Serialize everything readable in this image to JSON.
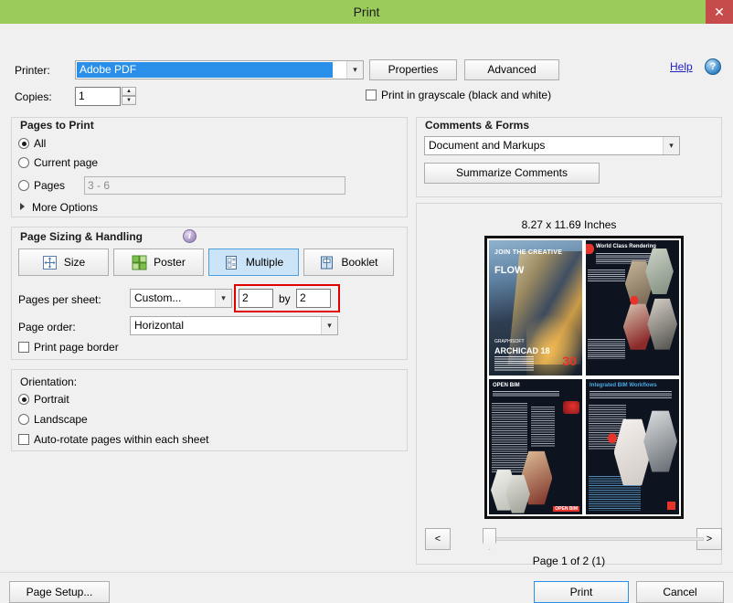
{
  "window": {
    "title": "Print",
    "close_label": "✕"
  },
  "printer": {
    "label": "Printer:",
    "selected": "Adobe PDF",
    "properties_label": "Properties",
    "advanced_label": "Advanced",
    "help_label": "Help",
    "help_icon": "?",
    "copies_label": "Copies:",
    "copies_value": "1",
    "spin_up": "▲",
    "spin_down": "▼",
    "grayscale_label": "Print in grayscale (black and white)",
    "grayscale_checked": false,
    "accent_selection": "#2a8fe8"
  },
  "pages_to_print": {
    "title": "Pages to Print",
    "all_label": "All",
    "current_page_label": "Current page",
    "pages_label": "Pages",
    "pages_placeholder": "3 - 6",
    "more_options_label": "More Options",
    "selected": "All"
  },
  "page_sizing": {
    "title": "Page Sizing & Handling",
    "info_icon": "i",
    "modes": [
      {
        "label": "Size",
        "icon": "resize-icon",
        "active": false
      },
      {
        "label": "Poster",
        "icon": "poster-grid-icon",
        "active": false
      },
      {
        "label": "Multiple",
        "icon": "multiple-pages-icon",
        "active": true
      },
      {
        "label": "Booklet",
        "icon": "booklet-icon",
        "active": false
      }
    ],
    "pages_per_sheet_label": "Pages per sheet:",
    "pages_per_sheet_value": "Custom...",
    "grid_x": "2",
    "by_label": "by",
    "grid_y": "2",
    "highlight_color": "#e00000",
    "page_order_label": "Page order:",
    "page_order_value": "Horizontal",
    "print_page_border_label": "Print page border",
    "print_page_border_checked": false
  },
  "orientation": {
    "title": "Orientation:",
    "portrait_label": "Portrait",
    "landscape_label": "Landscape",
    "selected": "Portrait",
    "auto_rotate_label": "Auto-rotate pages within each sheet",
    "auto_rotate_checked": false
  },
  "comments_forms": {
    "title": "Comments & Forms",
    "selected": "Document and Markups",
    "summarize_label": "Summarize Comments"
  },
  "preview": {
    "size_label": "8.27 x 11.69 Inches",
    "page_indicator": "Page 1 of 2 (1)",
    "prev_label": "<",
    "next_label": ">",
    "pages": [
      {
        "name": "archicad-cover",
        "headline": "JOIN THE CREATIVE",
        "headline2": "FLOW",
        "brand": "GRAPHISOFT",
        "product": "ARCHICAD 18",
        "badge": "30"
      },
      {
        "name": "world-class-rendering",
        "headline": "World Class Rendering"
      },
      {
        "name": "open-bim",
        "headline": "OPEN BIM",
        "logo_text": "OPEN BIM"
      },
      {
        "name": "integrated-bim-workflows",
        "headline": "Integrated BIM Workflows"
      }
    ]
  },
  "footer": {
    "page_setup_label": "Page Setup...",
    "print_label": "Print",
    "cancel_label": "Cancel"
  },
  "colors": {
    "titlebar_green": "#9bcb5b",
    "close_red": "#c64b4b",
    "dialog_bg": "#f0f0f0",
    "link_blue": "#2121c4"
  }
}
